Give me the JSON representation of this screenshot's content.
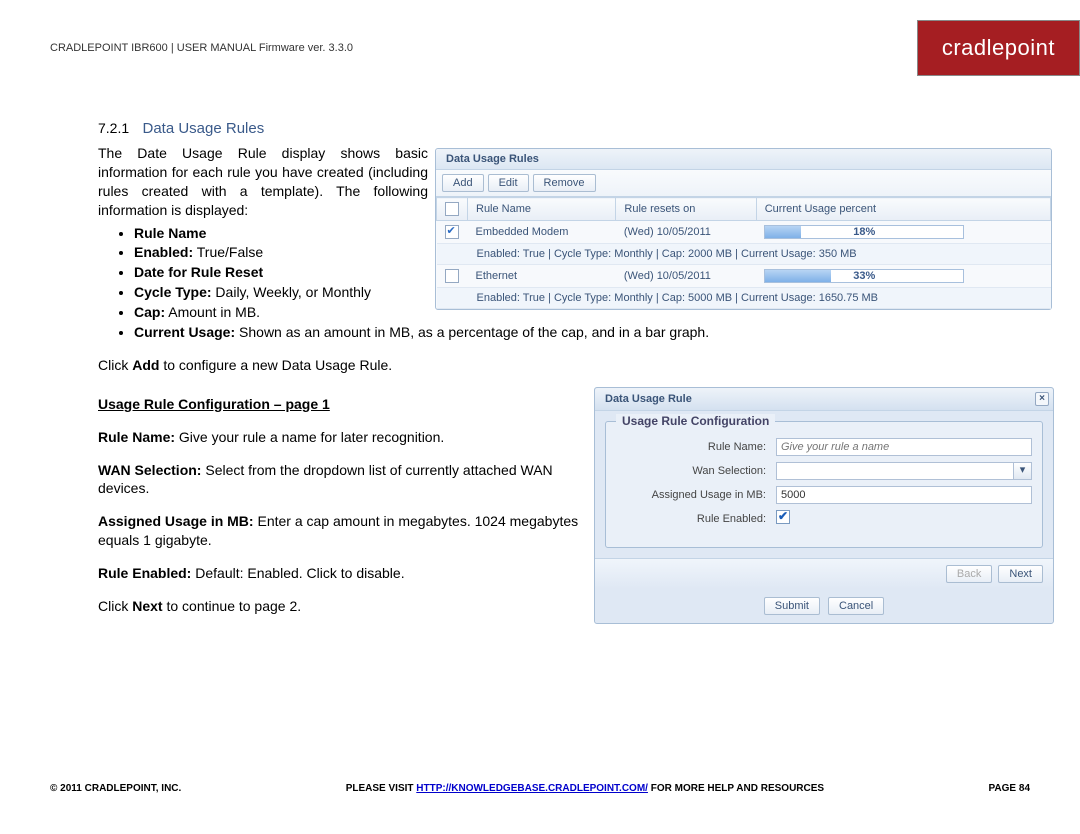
{
  "header": {
    "text": "CRADLEPOINT IBR600 | USER MANUAL Firmware ver. 3.3.0",
    "logo": "cradlepoint"
  },
  "section": {
    "number": "7.2.1",
    "title": "Data Usage Rules"
  },
  "intro": "The Date Usage Rule display shows basic information for each rule you have created (including rules created with a template). The following information is displayed:",
  "bullets": {
    "b1": "Rule Name",
    "b2a": "Enabled:",
    "b2b": " True/False",
    "b3": "Date for Rule Reset",
    "b4a": "Cycle Type:",
    "b4b": " Daily, Weekly, or Monthly",
    "b5a": "Cap:",
    "b5b": " Amount in MB.",
    "b6a": "Current Usage:",
    "b6b": " Shown as an amount in MB, as a percentage of the cap, and in a bar graph."
  },
  "click_add": {
    "pre": "Click ",
    "bold": "Add",
    "post": " to configure a new Data Usage Rule."
  },
  "subhead": "Usage Rule Configuration – page 1",
  "p1": {
    "bold": "Rule Name:",
    "rest": " Give your rule a name for later recognition."
  },
  "p2": {
    "bold": "WAN Selection:",
    "rest": " Select from the dropdown list of currently attached WAN devices."
  },
  "p3": {
    "bold": "Assigned Usage in MB:",
    "rest": " Enter a cap amount in megabytes. 1024 megabytes equals 1 gigabyte."
  },
  "p4": {
    "bold": "Rule Enabled:",
    "rest": " Default: Enabled. Click to disable."
  },
  "click_next": {
    "pre": "Click ",
    "bold": "Next",
    "post": " to continue to page 2."
  },
  "panel1": {
    "title": "Data Usage Rules",
    "btn_add": "Add",
    "btn_edit": "Edit",
    "btn_remove": "Remove",
    "col1": "Rule Name",
    "col2": "Rule resets on",
    "col3": "Current Usage percent",
    "row1": {
      "name": "Embedded Modem",
      "date": "(Wed) 10/05/2011",
      "pct": "18%",
      "pct_val": 18,
      "detail": "Enabled: True | Cycle Type: Monthly | Cap: 2000 MB | Current Usage: 350 MB"
    },
    "row2": {
      "name": "Ethernet",
      "date": "(Wed) 10/05/2011",
      "pct": "33%",
      "pct_val": 33,
      "detail": "Enabled: True | Cycle Type: Monthly | Cap: 5000 MB | Current Usage: 1650.75 MB"
    }
  },
  "panel2": {
    "title": "Data Usage Rule",
    "legend": "Usage Rule Configuration",
    "lbl_name": "Rule Name:",
    "ph_name": "Give your rule a name",
    "lbl_wan": "Wan Selection:",
    "lbl_mb": "Assigned Usage in MB:",
    "val_mb": "5000",
    "lbl_enabled": "Rule Enabled:",
    "btn_back": "Back",
    "btn_next": "Next",
    "btn_submit": "Submit",
    "btn_cancel": "Cancel"
  },
  "footer": {
    "left": "© 2011 CRADLEPOINT, INC.",
    "mid_pre": "PLEASE VISIT ",
    "mid_link": "HTTP://KNOWLEDGEBASE.CRADLEPOINT.COM/",
    "mid_post": " FOR MORE HELP AND RESOURCES",
    "right": "PAGE 84"
  },
  "chart_data": [
    {
      "type": "bar",
      "title": "Current Usage percent",
      "categories": [
        "Embedded Modem",
        "Ethernet"
      ],
      "values": [
        18,
        33
      ],
      "xlabel": "",
      "ylabel": "%",
      "ylim": [
        0,
        100
      ]
    }
  ]
}
